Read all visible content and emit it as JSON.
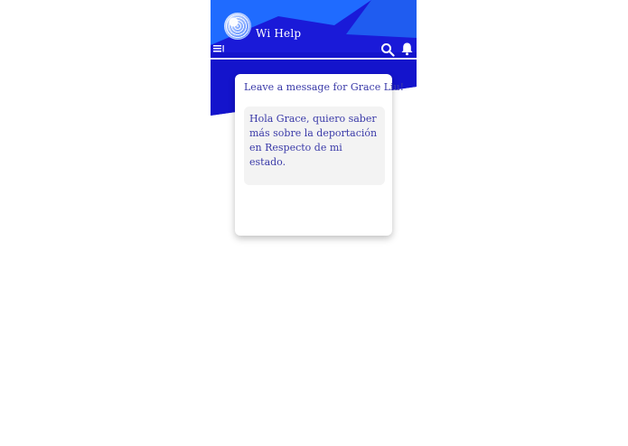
{
  "app": {
    "title": "Wi Help"
  },
  "icons": {
    "logo": "globe-logo",
    "menu": "menu-icon",
    "search": "search-icon",
    "notifications": "bell-icon"
  },
  "colors": {
    "header_primary": "#1E1EE0",
    "header_accent": "#1F6BFF",
    "text_blue": "#3A3AA8",
    "message_bg": "#F3F3F3"
  },
  "card": {
    "title": "Leave a message for Grace Liu!",
    "message": "Hola Grace, quiero saber más sobre la deportación en Respecto de mi estado."
  }
}
